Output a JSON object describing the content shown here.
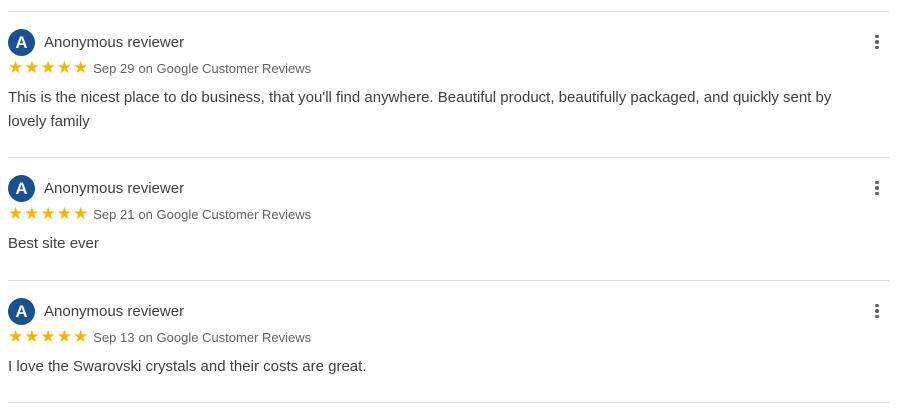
{
  "reviews": [
    {
      "avatar_letter": "A",
      "reviewer": "Anonymous reviewer",
      "stars": 5,
      "date": "Sep 29",
      "source": "on Google Customer Reviews",
      "text": "This is the nicest place to do business, that you'll find anywhere. Beautiful product, beautifully packaged, and quickly sent by lovely family"
    },
    {
      "avatar_letter": "A",
      "reviewer": "Anonymous reviewer",
      "stars": 5,
      "date": "Sep 21",
      "source": "on Google Customer Reviews",
      "text": "Best site ever"
    },
    {
      "avatar_letter": "A",
      "reviewer": "Anonymous reviewer",
      "stars": 5,
      "date": "Sep 13",
      "source": "on Google Customer Reviews",
      "text": "I love the Swarovski crystals and their costs are great."
    }
  ],
  "icons": {
    "star": "star-icon",
    "more": "more-vert-icon"
  },
  "colors": {
    "avatar": "#1a4f91",
    "star": "#f4b400",
    "divider": "#dadce0"
  }
}
